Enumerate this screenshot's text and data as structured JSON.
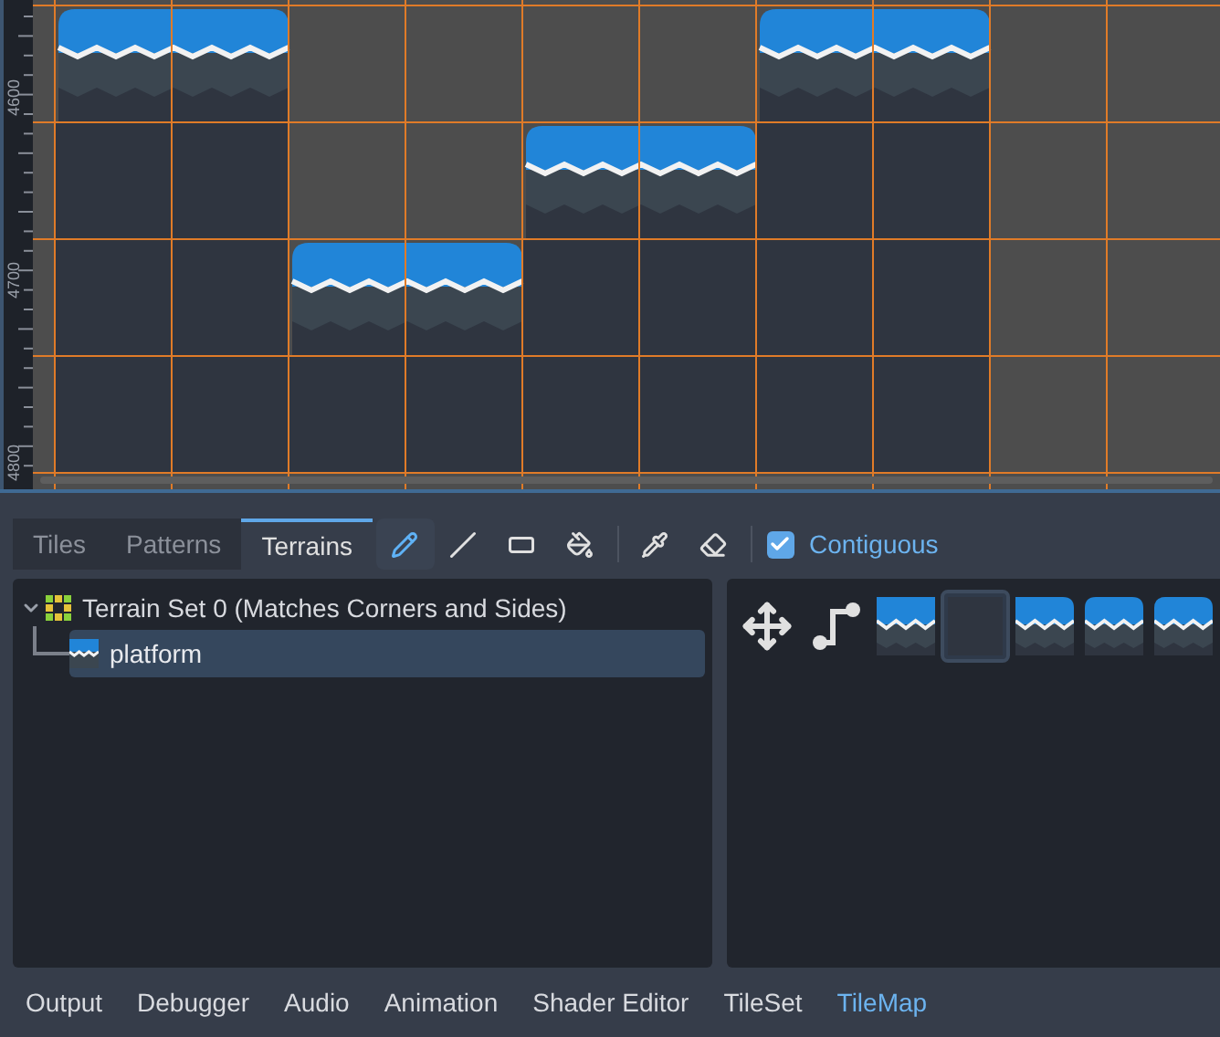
{
  "viewport": {
    "ruler_labels": [
      "4600",
      "4700",
      "4800"
    ]
  },
  "tabs": [
    {
      "label": "Tiles",
      "selected": false
    },
    {
      "label": "Patterns",
      "selected": false
    },
    {
      "label": "Terrains",
      "selected": true
    }
  ],
  "tools": [
    {
      "kind": "pencil",
      "selected": true
    },
    {
      "kind": "line",
      "selected": false
    },
    {
      "kind": "rect",
      "selected": false
    },
    {
      "kind": "bucket",
      "selected": false
    },
    {
      "kind": "separator"
    },
    {
      "kind": "picker",
      "selected": false
    },
    {
      "kind": "eraser",
      "selected": false
    },
    {
      "kind": "separator"
    }
  ],
  "contiguous": {
    "label": "Contiguous",
    "checked": true
  },
  "tree": {
    "label": "Terrain Set 0 (Matches Corners and Sides)",
    "expanded": true,
    "children": [
      {
        "label": "platform",
        "selected": true
      }
    ]
  },
  "palette": [
    {
      "kind": "connect",
      "selected": false
    },
    {
      "kind": "path",
      "selected": false
    },
    {
      "kind": "flat",
      "selected": false
    },
    {
      "kind": "empty",
      "selected": true
    },
    {
      "kind": "rightcap",
      "selected": false
    },
    {
      "kind": "capped",
      "selected": false
    },
    {
      "kind": "capped",
      "selected": false
    }
  ],
  "bottom_tabs": [
    {
      "label": "Output",
      "selected": false
    },
    {
      "label": "Debugger",
      "selected": false
    },
    {
      "label": "Audio",
      "selected": false
    },
    {
      "label": "Animation",
      "selected": false
    },
    {
      "label": "Shader Editor",
      "selected": false
    },
    {
      "label": "TileSet",
      "selected": false
    },
    {
      "label": "TileMap",
      "selected": true
    }
  ]
}
